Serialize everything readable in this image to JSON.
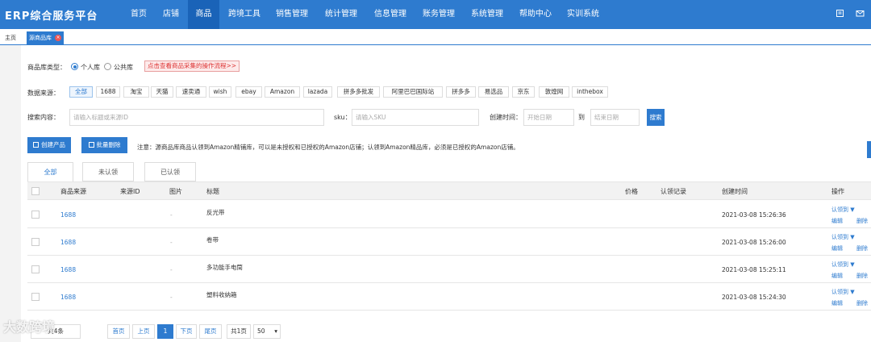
{
  "header": {
    "brand": "ERP综合服务平台",
    "nav": [
      "首页",
      "店铺",
      "商品",
      "跨境工具",
      "销售管理",
      "统计管理",
      "信息管理",
      "账务管理",
      "系统管理",
      "帮助中心",
      "实训系统"
    ],
    "active_nav": "商品",
    "icons": [
      "book-icon",
      "mail-icon"
    ]
  },
  "tabs": {
    "home": "主页",
    "source": "源商品库"
  },
  "filters": {
    "lib_type_label": "商品库类型：",
    "lib_personal": "个人库",
    "lib_public": "公共库",
    "flow_link": "点击查看商品采集的操作流程>>",
    "source_label": "数据来源：",
    "sources": [
      "全部",
      "1688",
      "淘宝",
      "天猫",
      "速卖通",
      "wish",
      "ebay",
      "Amazon",
      "lazada",
      "拼多多批发",
      "阿里巴巴国际站",
      "拼多多",
      "易选品",
      "京东",
      "敦煌网",
      "inthebox"
    ],
    "search_label": "搜索内容：",
    "search_placeholder": "请输入标题或来源ID",
    "sku_label": "sku：",
    "sku_placeholder": "请输入SKU",
    "created_label": "创建时间：",
    "start_placeholder": "开始日期",
    "to": "到",
    "end_placeholder": "结束日期",
    "search_btn": "搜索"
  },
  "actions": {
    "create": "创建产品",
    "batch_delete": "批量删除",
    "notice": "注意：源商品库商品认领到Amazon精铺库，可以是未授权和已授权的Amazon店铺；认领到Amazon精品库，必须是已授权的Amazon店铺。"
  },
  "filter_tabs": [
    "全部",
    "未认领",
    "已认领"
  ],
  "table": {
    "headers": {
      "source": "商品来源",
      "source_id": "来源ID",
      "image": "图片",
      "title": "标题",
      "price": "价格",
      "claim": "认领记录",
      "created": "创建时间",
      "ops": "操作"
    },
    "rows": [
      {
        "source": "1688",
        "image": "-",
        "title": "反光带",
        "created": "2021-03-08 15:26:36"
      },
      {
        "source": "1688",
        "image": "-",
        "title": "卷带",
        "created": "2021-03-08 15:26:00"
      },
      {
        "source": "1688",
        "image": "-",
        "title": "多功能手电筒",
        "created": "2021-03-08 15:25:11"
      },
      {
        "source": "1688",
        "image": "-",
        "title": "塑料收纳箱",
        "created": "2021-03-08 15:24:30"
      }
    ],
    "row_actions": {
      "claim": "认领到 ▼",
      "edit": "编辑",
      "delete": "删除"
    }
  },
  "pagination": {
    "total": "共4条",
    "first": "首页",
    "prev": "上页",
    "current": "1",
    "next": "下页",
    "last": "尾页",
    "pages": "共1页",
    "page_size": "50"
  },
  "watermark": "大数跨境"
}
